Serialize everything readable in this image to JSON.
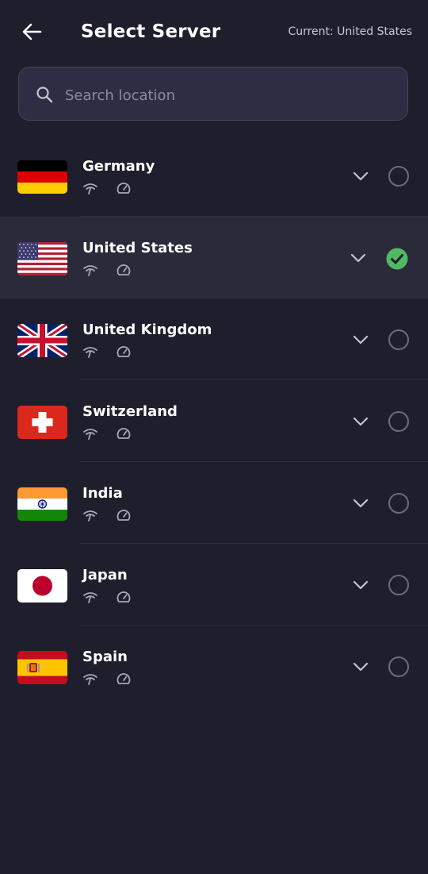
{
  "header": {
    "title": "Select Server",
    "current": "Current: United States"
  },
  "search": {
    "placeholder": "Search location",
    "value": ""
  },
  "colors": {
    "background": "#1f1e2c",
    "selected_row": "#2b2a3a",
    "check_green": "#52b862"
  },
  "servers": [
    {
      "name": "Germany",
      "flag": "flag-germany",
      "selected": false
    },
    {
      "name": "United States",
      "flag": "flag-united-states",
      "selected": true
    },
    {
      "name": "United Kingdom",
      "flag": "flag-united-kingdom",
      "selected": false
    },
    {
      "name": "Switzerland",
      "flag": "flag-switzerland",
      "selected": false
    },
    {
      "name": "India",
      "flag": "flag-india",
      "selected": false
    },
    {
      "name": "Japan",
      "flag": "flag-japan",
      "selected": false
    },
    {
      "name": "Spain",
      "flag": "flag-spain",
      "selected": false
    }
  ]
}
